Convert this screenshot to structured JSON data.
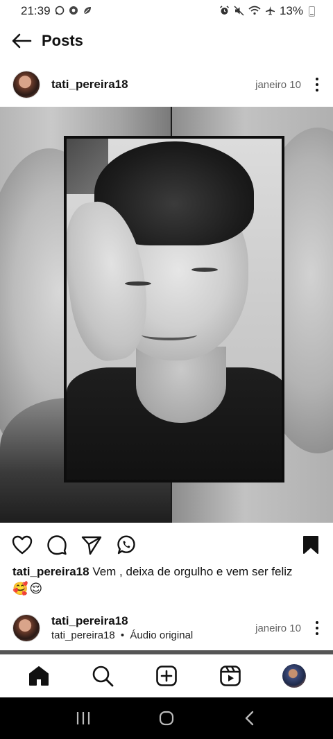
{
  "status_bar": {
    "time": "21:39",
    "left_icons": [
      "whatsapp-icon",
      "chrome-icon",
      "leaf-icon"
    ],
    "right_icons": [
      "alarm-icon",
      "mute-icon",
      "wifi-icon",
      "airplane-icon"
    ],
    "battery": "13%"
  },
  "header": {
    "title": "Posts"
  },
  "post": {
    "username": "tati_pereira18",
    "date": "janeiro 10",
    "caption_user": "tati_pereira18",
    "caption_text": "Vem , deixa de orgulho e vem ser feliz",
    "caption_emoji": "🥰😌",
    "actions": [
      "like-icon",
      "comment-icon",
      "share-icon",
      "whatsapp-icon"
    ],
    "saved_icon": "bookmark-filled-icon"
  },
  "next_post": {
    "username": "tati_pereira18",
    "audio_user": "tati_pereira18",
    "audio_sep": "•",
    "audio_label": "Áudio original",
    "date": "janeiro 10"
  },
  "bottom_nav": [
    "home-icon",
    "search-icon",
    "create-icon",
    "reels-icon",
    "profile-avatar"
  ],
  "system_nav": [
    "recents-icon",
    "home-circle-icon",
    "back-chevron-icon"
  ]
}
